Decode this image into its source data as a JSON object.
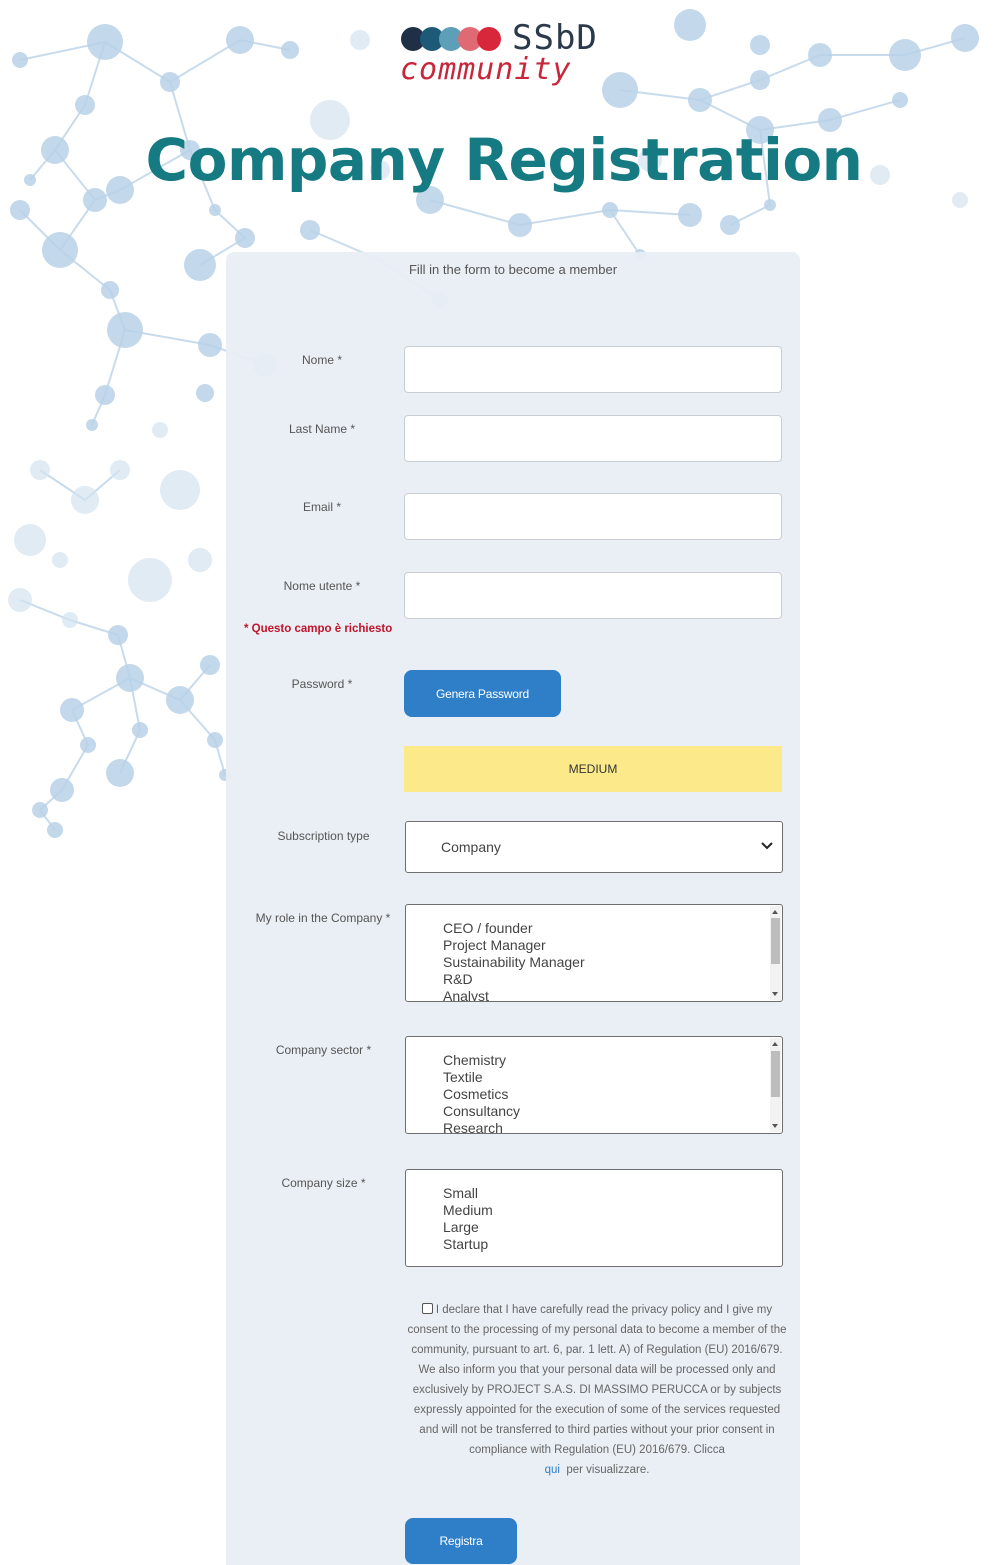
{
  "logo": {
    "top_text": "SSbD",
    "bottom_text": "community"
  },
  "page": {
    "title": "Company Registration",
    "subtitle": "Fill in the form to become a member"
  },
  "form": {
    "fields": {
      "nome": {
        "label": "Nome *",
        "value": ""
      },
      "last_name": {
        "label": "Last Name *",
        "value": ""
      },
      "email": {
        "label": "Email *",
        "value": ""
      },
      "nome_utente": {
        "label": "Nome utente *",
        "value": ""
      }
    },
    "error_required": "* Questo campo è richiesto",
    "password": {
      "label": "Password *",
      "generate_button": "Genera Password",
      "strength": "MEDIUM"
    },
    "subscription_type": {
      "label": "Subscription type",
      "selected": "Company"
    },
    "role": {
      "label": "My role in the Company *",
      "options": [
        "CEO / founder",
        "Project Manager",
        "Sustainability Manager",
        "R&D",
        "Analyst"
      ]
    },
    "sector": {
      "label": "Company sector *",
      "options": [
        "Chemistry",
        "Textile",
        "Cosmetics",
        "Consultancy",
        "Research"
      ]
    },
    "size": {
      "label": "Company size *",
      "options": [
        "Small",
        "Medium",
        "Large",
        "Startup"
      ]
    },
    "consent": {
      "text": "I declare that I have carefully read the privacy policy and I give my consent to the processing of my personal data to become a member of the community, pursuant to art. 6, par. 1 lett. A) of Regulation (EU) 2016/679. We also inform you that your personal data will be processed only and exclusively by PROJECT S.A.S. DI MASSIMO PERUCCA or by subjects expressly appointed for the execution of some of the services requested and will not be transferred to third parties without your prior consent in compliance with Regulation (EU) 2016/679. Clicca",
      "link": "qui",
      "after_link": "per visualizzare."
    },
    "submit": "Registra"
  },
  "colors": {
    "title": "#157a82",
    "button": "#2f7fc8",
    "strength_medium": "#fbe98a",
    "error": "#c0142a",
    "logo_red": "#c8263a"
  }
}
